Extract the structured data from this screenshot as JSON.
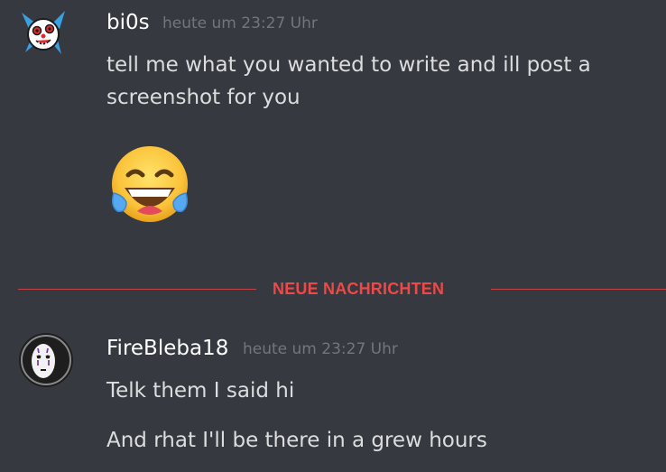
{
  "messages": [
    {
      "author": "bi0s",
      "timestamp": "heute um 23:27 Uhr",
      "avatar_icon": "clown-skull-icon",
      "lines": [
        "tell me what you wanted to write and ill post a",
        "screenshot for you"
      ],
      "emoji": "joy-emoji-icon"
    },
    {
      "author": "FireBleba18",
      "timestamp": "heute um 23:27 Uhr",
      "avatar_icon": "no-face-mask-icon",
      "lines": [
        "Telk them I said hi",
        "And rhat I'll be there in a grew hours"
      ]
    }
  ],
  "divider": {
    "label": "NEUE NACHRICHTEN"
  },
  "colors": {
    "background": "#36393f",
    "username": "#ffffff",
    "message_text": "#dcddde",
    "timestamp": "#72767d",
    "new_messages_accent": "#f04747"
  }
}
